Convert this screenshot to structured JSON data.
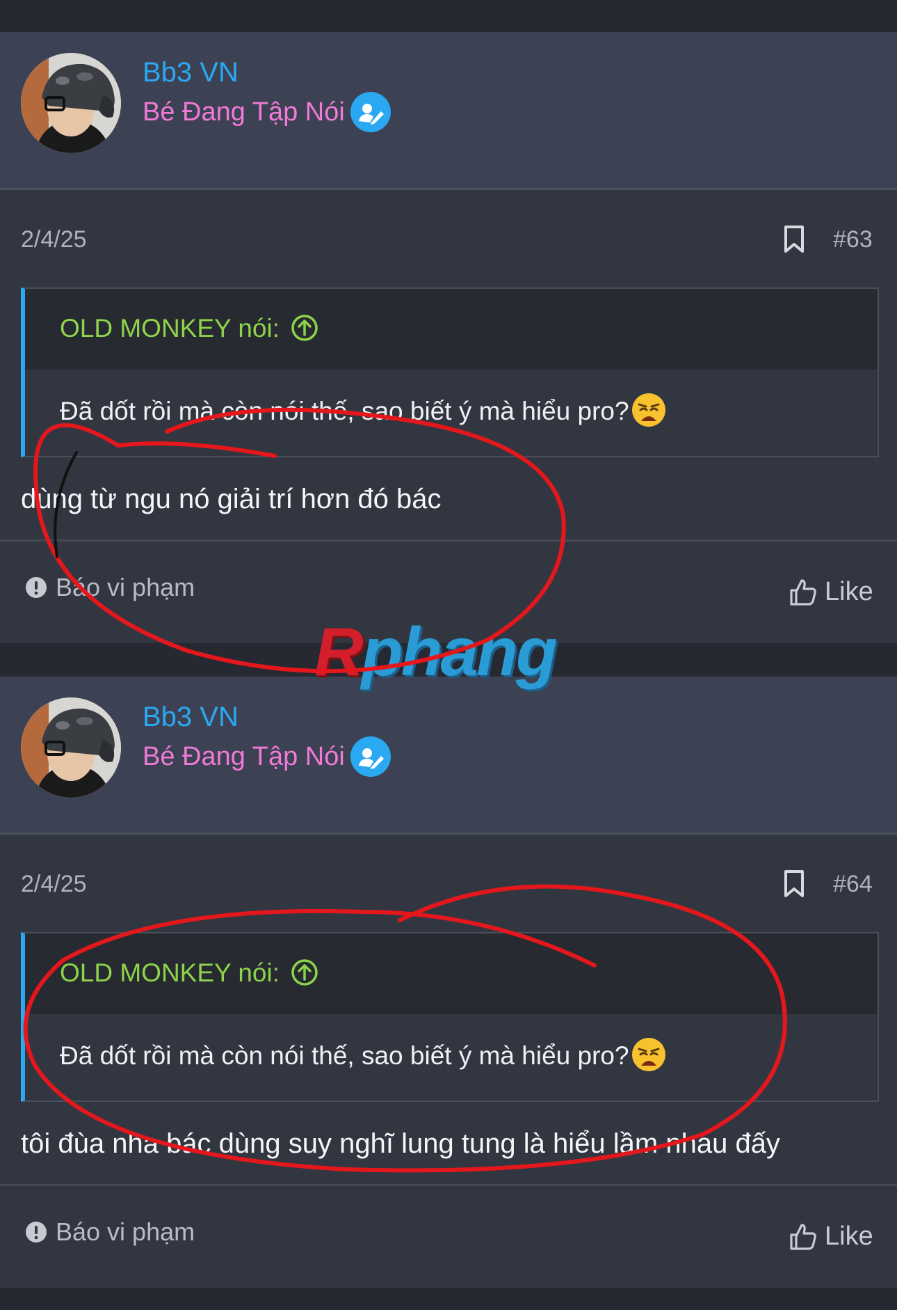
{
  "posts": [
    {
      "username": "Bb3 VN",
      "user_title": "Bé Đang Tập Nói",
      "date": "2/4/25",
      "post_number": "#63",
      "quote": {
        "author": "OLD MONKEY nói:",
        "text": "Đã dốt rồi mà còn nói thế, sao biết ý mà hiểu pro?"
      },
      "message": "dùng từ ngu nó giải trí hơn đó bác",
      "report_label": "Báo vi phạm",
      "like_label": "Like"
    },
    {
      "username": "Bb3 VN",
      "user_title": "Bé Đang Tập Nói",
      "date": "2/4/25",
      "post_number": "#64",
      "quote": {
        "author": "OLD MONKEY nói:",
        "text": "Đã dốt rồi mà còn nói thế, sao biết ý mà hiểu pro?"
      },
      "message": "tôi đùa nha bác dùng suy nghĩ lung tung là hiểu lầm nhau đấy",
      "report_label": "Báo vi phạm",
      "like_label": "Like"
    }
  ],
  "watermark": {
    "first_letter": "R",
    "rest": "phang"
  },
  "icons": {
    "badge": "user-edit-icon",
    "bookmark": "bookmark-icon",
    "quote_arrow": "arrow-up-circle-icon",
    "report": "exclamation-circle-icon",
    "like": "thumbs-up-icon",
    "emoji": "weary-face-emoji"
  },
  "colors": {
    "username": "#2aa8f2",
    "user_title": "#f07ad6",
    "quote_author": "#8ed44a",
    "quote_border": "#2aa8f2",
    "annotation": "#e4181c"
  }
}
